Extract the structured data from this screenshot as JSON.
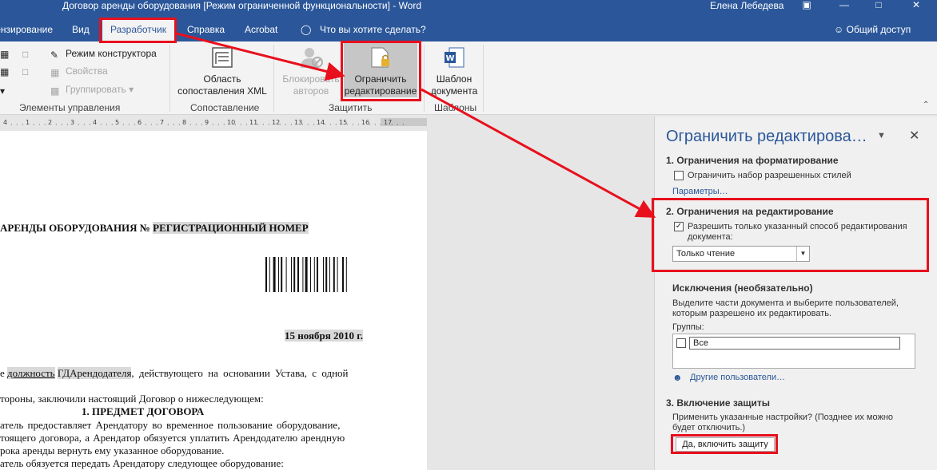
{
  "titlebar": {
    "title": "Договор аренды оборудования [Режим ограниченной функциональности]  -  Word",
    "user": "Елена Лебедева"
  },
  "tabs": [
    {
      "label": "Рецензирование"
    },
    {
      "label": "Вид"
    },
    {
      "label": "Разработчик"
    },
    {
      "label": "Справка"
    },
    {
      "label": "Acrobat"
    }
  ],
  "tellme": "Что вы хотите сделать?",
  "share": "Общий доступ",
  "ribbon": {
    "design_mode": "Режим конструктора",
    "properties": "Свойства",
    "group": "Группировать",
    "controls_group": "Элементы управления",
    "xml_pane": [
      "Область",
      "сопоставления XML"
    ],
    "mapping_group": "Сопоставление",
    "block_authors": [
      "Блокировать",
      "авторов"
    ],
    "restrict_editing": [
      "Ограничить",
      "редактирование"
    ],
    "protect_group": "Защитить",
    "template": [
      "Шаблон",
      "документа"
    ],
    "templates_group": "Шаблоны"
  },
  "ruler": [
    "4",
    "1",
    "2",
    "3",
    "4",
    "5",
    "6",
    "7",
    "8",
    "9",
    "10",
    "11",
    "12",
    "13",
    "14",
    "15",
    "16",
    "17"
  ],
  "document": {
    "heading_plain": "АРЕНДЫ ОБОРУДОВАНИЯ № ",
    "heading_field": "РЕГИСТРАЦИОННЫЙ НОМЕР",
    "date": "15 ноября 2010 г.",
    "p1_prefix": "е ",
    "p1_field1": "должность",
    "p1_field2": "ГДАрендодателя",
    "p1_suffix": ", действующего на основании Устава, с одной",
    "p2": "тороны, заключили настоящий Договор о нижеследующем:",
    "section": "1.    ПРЕДМЕТ ДОГОВОРА",
    "p3": "атель предоставляет Арендатору во временное пользование оборудование,",
    "p4": "тоящего договора, а Арендатор обязуется уплатить Арендодателю арендную",
    "p5": "рока аренды вернуть ему указанное оборудование.",
    "p6": "атель обязуется передать Арендатору следующее оборудование:"
  },
  "pane": {
    "title": "Ограничить редактирова…",
    "s1": "1. Ограничения на форматирование",
    "s1_check": "Ограничить набор разрешенных стилей",
    "s1_check_value": false,
    "s1_link": "Параметры…",
    "s2": "2. Ограничения на редактирование",
    "s2_check_line1": "Разрешить только указанный способ редактирования",
    "s2_check_line2": "документа:",
    "s2_check_value": true,
    "s2_select": "Только чтение",
    "ex_title": "Исключения (необязательно)",
    "ex_text1": "Выделите части документа и выберите пользователей,",
    "ex_text2": "которым разрешено их редактировать.",
    "groups_label": "Группы:",
    "groups_item": "Все",
    "other_users": "Другие пользователи…",
    "s3": "3. Включение защиты",
    "s3_text1": "Применить указанные настройки? (Позднее их можно",
    "s3_text2": "будет отключить.)",
    "s3_button": "Да, включить защиту"
  },
  "colors": {
    "accent": "#2b579a",
    "annotation": "#e8101d"
  }
}
